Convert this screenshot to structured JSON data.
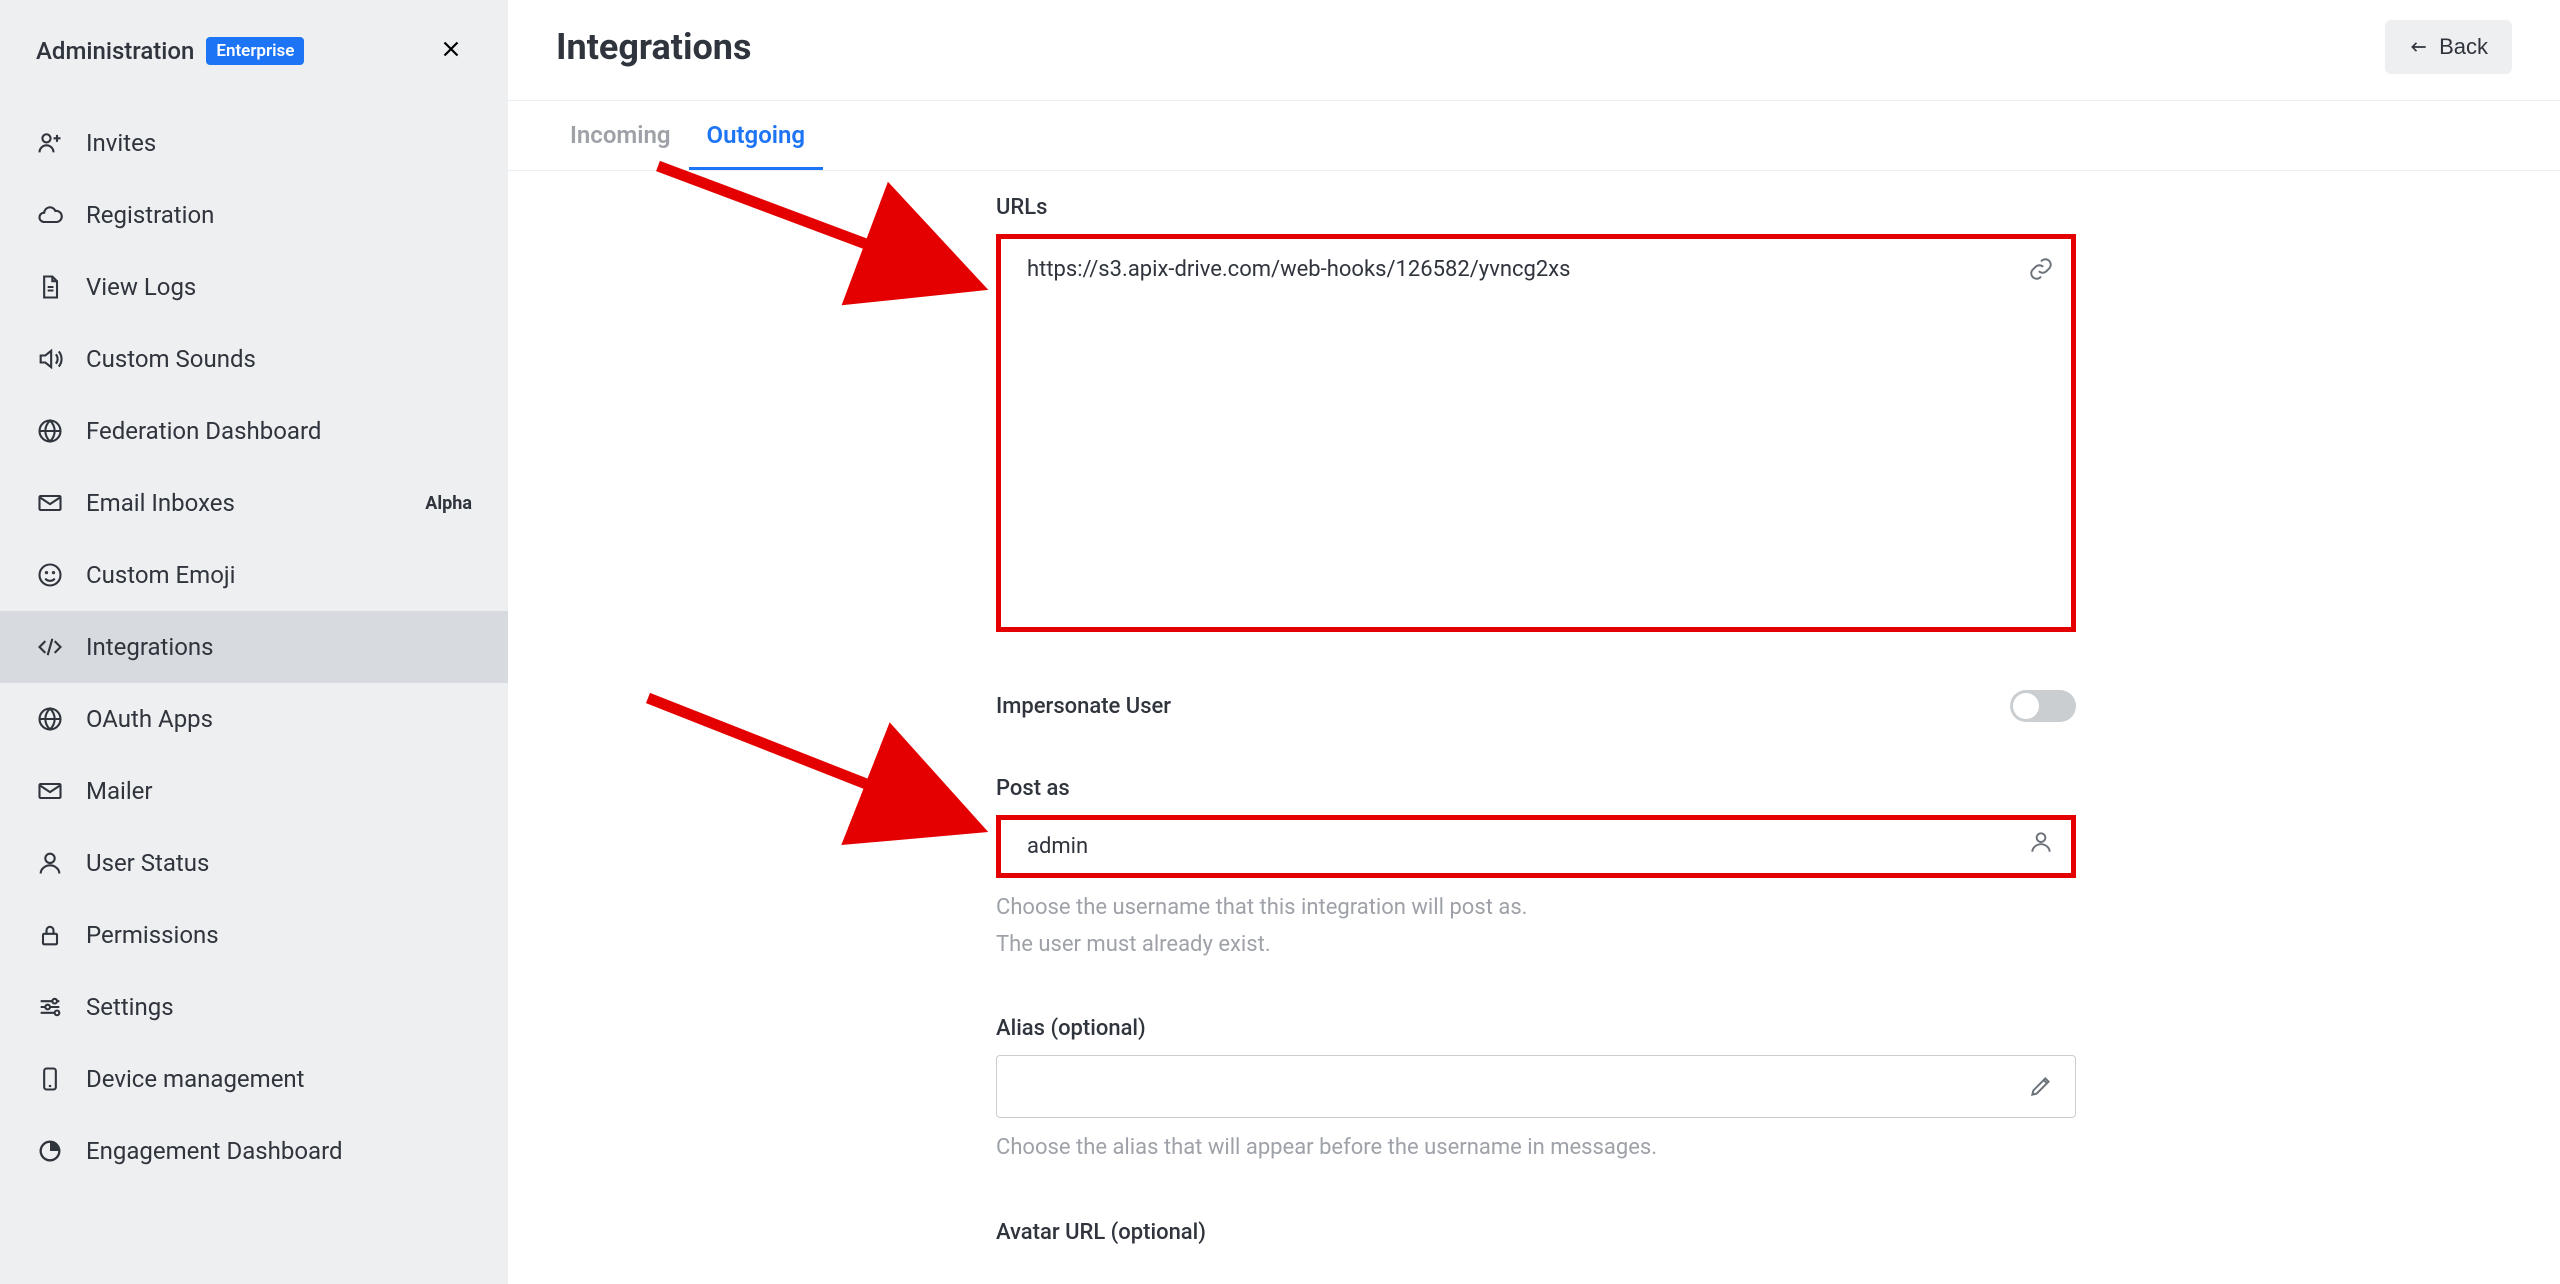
{
  "sidebar": {
    "title": "Administration",
    "badge": "Enterprise",
    "items": [
      {
        "label": "Invites",
        "icon": "invite"
      },
      {
        "label": "Registration",
        "icon": "cloud"
      },
      {
        "label": "View Logs",
        "icon": "file"
      },
      {
        "label": "Custom Sounds",
        "icon": "sound"
      },
      {
        "label": "Federation Dashboard",
        "icon": "globe"
      },
      {
        "label": "Email Inboxes",
        "icon": "mail",
        "badge": "Alpha"
      },
      {
        "label": "Custom Emoji",
        "icon": "emoji"
      },
      {
        "label": "Integrations",
        "icon": "code",
        "active": true
      },
      {
        "label": "OAuth Apps",
        "icon": "globe"
      },
      {
        "label": "Mailer",
        "icon": "mail"
      },
      {
        "label": "User Status",
        "icon": "user"
      },
      {
        "label": "Permissions",
        "icon": "lock"
      },
      {
        "label": "Settings",
        "icon": "settings"
      },
      {
        "label": "Device management",
        "icon": "device"
      },
      {
        "label": "Engagement Dashboard",
        "icon": "pie"
      }
    ]
  },
  "header": {
    "title": "Integrations",
    "back": "Back"
  },
  "tabs": {
    "incoming": "Incoming",
    "outgoing": "Outgoing"
  },
  "form": {
    "urls_label": "URLs",
    "urls_value": "https://s3.apix-drive.com/web-hooks/126582/yvncg2xs",
    "impersonate_label": "Impersonate User",
    "postas_label": "Post as",
    "postas_value": "admin",
    "postas_help1": "Choose the username that this integration will post as.",
    "postas_help2": "The user must already exist.",
    "alias_label": "Alias (optional)",
    "alias_value": "",
    "alias_help": "Choose the alias that will appear before the username in messages.",
    "avatar_label": "Avatar URL (optional)"
  },
  "annotation": {
    "highlight_color": "#e40000"
  }
}
